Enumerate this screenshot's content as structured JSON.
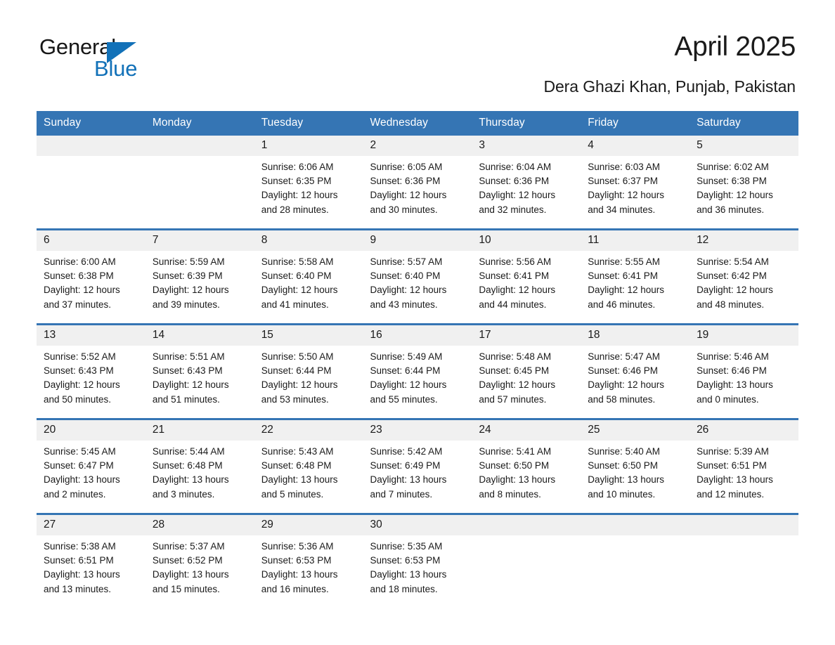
{
  "brand": {
    "name_part1": "General",
    "name_part2": "Blue"
  },
  "header": {
    "title": "April 2025",
    "subtitle": "Dera Ghazi Khan, Punjab, Pakistan"
  },
  "colors": {
    "header_blue": "#3575b4",
    "logo_blue": "#1271b8",
    "daynum_band": "#f0f0f0",
    "text": "#1a1a1a"
  },
  "weekdays": [
    "Sunday",
    "Monday",
    "Tuesday",
    "Wednesday",
    "Thursday",
    "Friday",
    "Saturday"
  ],
  "weeks": [
    [
      {
        "day": "",
        "info": ""
      },
      {
        "day": "",
        "info": ""
      },
      {
        "day": "1",
        "info": "Sunrise: 6:06 AM\nSunset: 6:35 PM\nDaylight: 12 hours\nand 28 minutes."
      },
      {
        "day": "2",
        "info": "Sunrise: 6:05 AM\nSunset: 6:36 PM\nDaylight: 12 hours\nand 30 minutes."
      },
      {
        "day": "3",
        "info": "Sunrise: 6:04 AM\nSunset: 6:36 PM\nDaylight: 12 hours\nand 32 minutes."
      },
      {
        "day": "4",
        "info": "Sunrise: 6:03 AM\nSunset: 6:37 PM\nDaylight: 12 hours\nand 34 minutes."
      },
      {
        "day": "5",
        "info": "Sunrise: 6:02 AM\nSunset: 6:38 PM\nDaylight: 12 hours\nand 36 minutes."
      }
    ],
    [
      {
        "day": "6",
        "info": "Sunrise: 6:00 AM\nSunset: 6:38 PM\nDaylight: 12 hours\nand 37 minutes."
      },
      {
        "day": "7",
        "info": "Sunrise: 5:59 AM\nSunset: 6:39 PM\nDaylight: 12 hours\nand 39 minutes."
      },
      {
        "day": "8",
        "info": "Sunrise: 5:58 AM\nSunset: 6:40 PM\nDaylight: 12 hours\nand 41 minutes."
      },
      {
        "day": "9",
        "info": "Sunrise: 5:57 AM\nSunset: 6:40 PM\nDaylight: 12 hours\nand 43 minutes."
      },
      {
        "day": "10",
        "info": "Sunrise: 5:56 AM\nSunset: 6:41 PM\nDaylight: 12 hours\nand 44 minutes."
      },
      {
        "day": "11",
        "info": "Sunrise: 5:55 AM\nSunset: 6:41 PM\nDaylight: 12 hours\nand 46 minutes."
      },
      {
        "day": "12",
        "info": "Sunrise: 5:54 AM\nSunset: 6:42 PM\nDaylight: 12 hours\nand 48 minutes."
      }
    ],
    [
      {
        "day": "13",
        "info": "Sunrise: 5:52 AM\nSunset: 6:43 PM\nDaylight: 12 hours\nand 50 minutes."
      },
      {
        "day": "14",
        "info": "Sunrise: 5:51 AM\nSunset: 6:43 PM\nDaylight: 12 hours\nand 51 minutes."
      },
      {
        "day": "15",
        "info": "Sunrise: 5:50 AM\nSunset: 6:44 PM\nDaylight: 12 hours\nand 53 minutes."
      },
      {
        "day": "16",
        "info": "Sunrise: 5:49 AM\nSunset: 6:44 PM\nDaylight: 12 hours\nand 55 minutes."
      },
      {
        "day": "17",
        "info": "Sunrise: 5:48 AM\nSunset: 6:45 PM\nDaylight: 12 hours\nand 57 minutes."
      },
      {
        "day": "18",
        "info": "Sunrise: 5:47 AM\nSunset: 6:46 PM\nDaylight: 12 hours\nand 58 minutes."
      },
      {
        "day": "19",
        "info": "Sunrise: 5:46 AM\nSunset: 6:46 PM\nDaylight: 13 hours\nand 0 minutes."
      }
    ],
    [
      {
        "day": "20",
        "info": "Sunrise: 5:45 AM\nSunset: 6:47 PM\nDaylight: 13 hours\nand 2 minutes."
      },
      {
        "day": "21",
        "info": "Sunrise: 5:44 AM\nSunset: 6:48 PM\nDaylight: 13 hours\nand 3 minutes."
      },
      {
        "day": "22",
        "info": "Sunrise: 5:43 AM\nSunset: 6:48 PM\nDaylight: 13 hours\nand 5 minutes."
      },
      {
        "day": "23",
        "info": "Sunrise: 5:42 AM\nSunset: 6:49 PM\nDaylight: 13 hours\nand 7 minutes."
      },
      {
        "day": "24",
        "info": "Sunrise: 5:41 AM\nSunset: 6:50 PM\nDaylight: 13 hours\nand 8 minutes."
      },
      {
        "day": "25",
        "info": "Sunrise: 5:40 AM\nSunset: 6:50 PM\nDaylight: 13 hours\nand 10 minutes."
      },
      {
        "day": "26",
        "info": "Sunrise: 5:39 AM\nSunset: 6:51 PM\nDaylight: 13 hours\nand 12 minutes."
      }
    ],
    [
      {
        "day": "27",
        "info": "Sunrise: 5:38 AM\nSunset: 6:51 PM\nDaylight: 13 hours\nand 13 minutes."
      },
      {
        "day": "28",
        "info": "Sunrise: 5:37 AM\nSunset: 6:52 PM\nDaylight: 13 hours\nand 15 minutes."
      },
      {
        "day": "29",
        "info": "Sunrise: 5:36 AM\nSunset: 6:53 PM\nDaylight: 13 hours\nand 16 minutes."
      },
      {
        "day": "30",
        "info": "Sunrise: 5:35 AM\nSunset: 6:53 PM\nDaylight: 13 hours\nand 18 minutes."
      },
      {
        "day": "",
        "info": ""
      },
      {
        "day": "",
        "info": ""
      },
      {
        "day": "",
        "info": ""
      }
    ]
  ]
}
